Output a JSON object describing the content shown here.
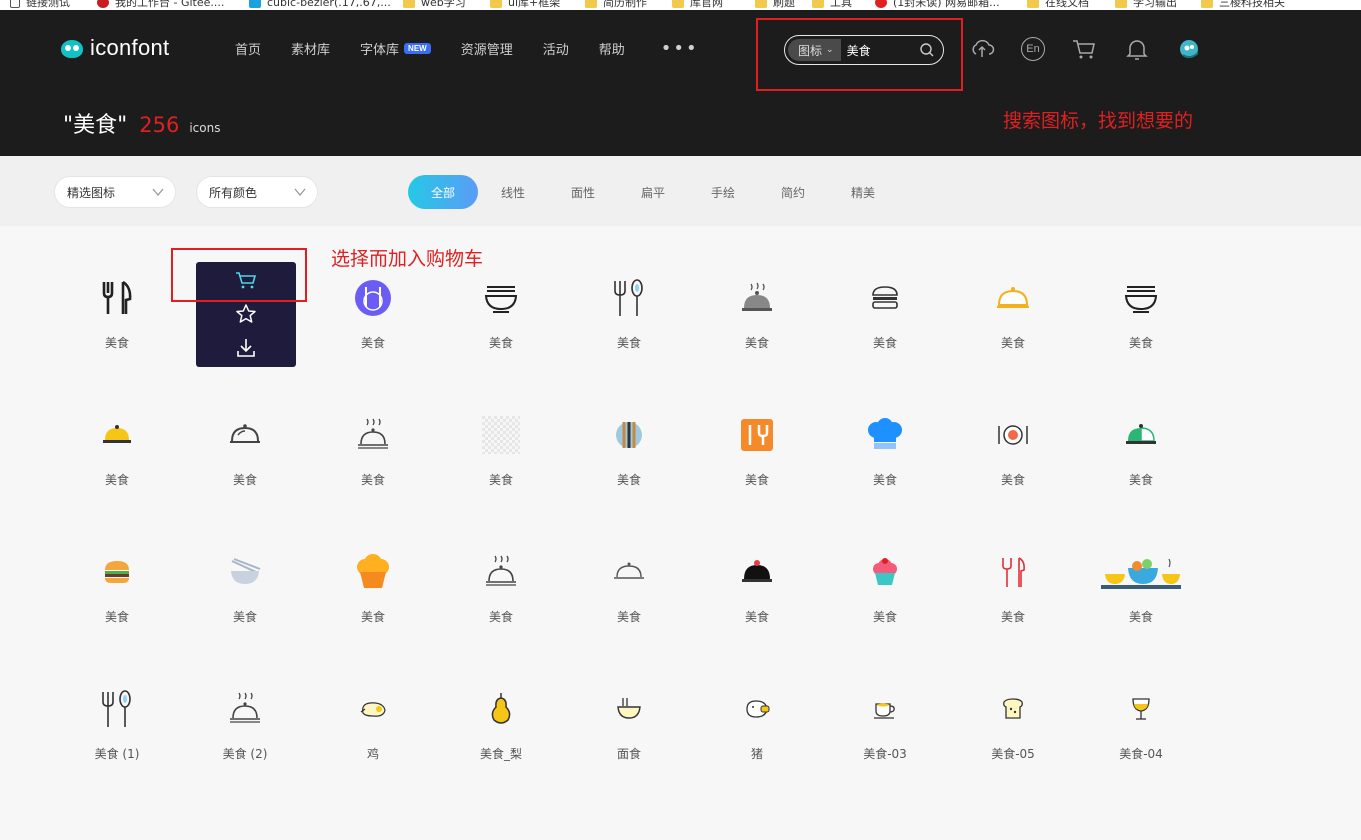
{
  "bookmarks": [
    {
      "label": "链接测试",
      "icon": "page"
    },
    {
      "label": "我的工作台 - Gitee....",
      "icon": "gitee"
    },
    {
      "label": "cubic-bezier(.17,.67,...",
      "icon": "cubic"
    },
    {
      "label": "web学习",
      "icon": "folder"
    },
    {
      "label": "ui库+框架",
      "icon": "folder"
    },
    {
      "label": "简历制作",
      "icon": "folder"
    },
    {
      "label": "库官网",
      "icon": "folder"
    },
    {
      "label": "刷题",
      "icon": "folder"
    },
    {
      "label": "工具",
      "icon": "folder"
    },
    {
      "label": "(1封未读) 网易邮箱...",
      "icon": "red"
    },
    {
      "label": "在线文档",
      "icon": "folder"
    },
    {
      "label": "学习输出",
      "icon": "folder"
    },
    {
      "label": "三棱科技相关",
      "icon": "folder"
    }
  ],
  "header": {
    "logo_text": "iconfont",
    "nav": [
      "首页",
      "素材库",
      "字体库",
      "资源管理",
      "活动",
      "帮助"
    ],
    "nav_badge": "NEW",
    "more_label": "•••",
    "search": {
      "type_label": "图标",
      "value": "美食",
      "placeholder": ""
    },
    "icons": [
      "upload-icon",
      "language-en-icon",
      "cart-icon",
      "bell-icon",
      "avatar"
    ],
    "lang_label": "En"
  },
  "annotations": {
    "search_note": "搜索图标，找到想要的",
    "cart_note": "选择而加入购物车"
  },
  "result": {
    "query": "\"美食\"",
    "count": "256",
    "unit": "icons"
  },
  "filters": {
    "select_1": "精选图标",
    "select_2": "所有颜色",
    "tabs": [
      "全部",
      "线性",
      "面性",
      "扁平",
      "手绘",
      "简约",
      "精美"
    ],
    "active_tab": "全部"
  },
  "colors": {
    "header_bg": "#1c1c1d",
    "accent_red": "#e02020",
    "tab_gradient_start": "#25c8e6",
    "tab_gradient_end": "#5b9cf6",
    "hover_card_bg": "#1f1b3d"
  },
  "icons": [
    {
      "label": "美食",
      "icon": "fork-knife-icon"
    },
    {
      "label": "美食",
      "icon": "hovered-icon"
    },
    {
      "label": "美食",
      "icon": "plate-cutlery-circle-icon"
    },
    {
      "label": "美食",
      "icon": "noodle-bowl-icon"
    },
    {
      "label": "美食",
      "icon": "fork-spoon-icon"
    },
    {
      "label": "美食",
      "icon": "cloche-steam-icon"
    },
    {
      "label": "美食",
      "icon": "burger-outline-icon"
    },
    {
      "label": "美食",
      "icon": "cloche-yellow-icon"
    },
    {
      "label": "美食",
      "icon": "noodle-bowl-icon"
    },
    {
      "label": "美食",
      "icon": "cloche-gold-icon"
    },
    {
      "label": "美食",
      "icon": "cloche-outline-icon"
    },
    {
      "label": "美食",
      "icon": "cloche-steam-outline-icon"
    },
    {
      "label": "美食",
      "icon": "transparent-placeholder-icon"
    },
    {
      "label": "美食",
      "icon": "fork-knife-circle-icon"
    },
    {
      "label": "美食",
      "icon": "orange-menu-card-icon"
    },
    {
      "label": "美食",
      "icon": "chef-hat-icon"
    },
    {
      "label": "美食",
      "icon": "dinner-plate-icon"
    },
    {
      "label": "美食",
      "icon": "cloche-green-icon"
    },
    {
      "label": "美食",
      "icon": "burger-color-icon"
    },
    {
      "label": "美食",
      "icon": "bowl-chopsticks-icon"
    },
    {
      "label": "美食",
      "icon": "muffin-icon"
    },
    {
      "label": "美食",
      "icon": "cloche-steam-outline-icon"
    },
    {
      "label": "美食",
      "icon": "cloche-line-icon"
    },
    {
      "label": "美食",
      "icon": "cloche-black-icon"
    },
    {
      "label": "美食",
      "icon": "cupcake-icon"
    },
    {
      "label": "美食",
      "icon": "fork-knife-red-icon"
    },
    {
      "label": "美食",
      "icon": "food-table-icon"
    },
    {
      "label": "美食 (1)",
      "icon": "fork-spoon-icon"
    },
    {
      "label": "美食 (2)",
      "icon": "cloche-steam-outline-icon"
    },
    {
      "label": "鸡",
      "icon": "chicken-icon"
    },
    {
      "label": "美食_梨",
      "icon": "pear-icon"
    },
    {
      "label": "面食",
      "icon": "noodle-bowl-color-icon"
    },
    {
      "label": "猪",
      "icon": "pig-icon"
    },
    {
      "label": "美食-03",
      "icon": "coffee-cup-icon"
    },
    {
      "label": "美食-05",
      "icon": "toast-icon"
    },
    {
      "label": "美食-04",
      "icon": "wine-glass-icon"
    }
  ],
  "hover_actions": [
    "cart-icon",
    "star-icon",
    "download-icon"
  ]
}
